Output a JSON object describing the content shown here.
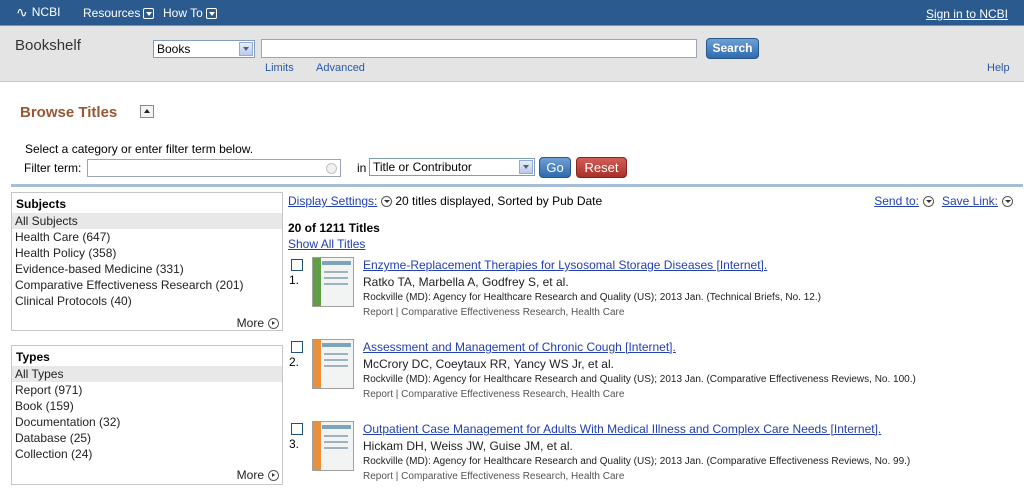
{
  "topbar": {
    "logo_text": "NCBI",
    "menus": [
      "Resources",
      "How To"
    ],
    "signin": "Sign in to NCBI"
  },
  "search": {
    "app_title": "Bookshelf",
    "database": "Books",
    "query": "",
    "button": "Search",
    "limits": "Limits",
    "advanced": "Advanced",
    "help": "Help"
  },
  "browse": {
    "title": "Browse Titles",
    "instructions": "Select a category or enter filter term below.",
    "filter_label": "Filter term:",
    "filter_value": "",
    "in_label": "in",
    "field": "Title or Contributor",
    "go": "Go",
    "reset": "Reset"
  },
  "subjects": {
    "heading": "Subjects",
    "items": [
      "All Subjects",
      "Health Care (647)",
      "Health Policy (358)",
      "Evidence-based Medicine (331)",
      "Comparative Effectiveness Research (201)",
      "Clinical Protocols (40)"
    ],
    "more": "More"
  },
  "types": {
    "heading": "Types",
    "items": [
      "All Types",
      "Report (971)",
      "Book (159)",
      "Documentation (32)",
      "Database (25)",
      "Collection (24)"
    ],
    "more": "More"
  },
  "results_bar": {
    "display_settings": "Display Settings:",
    "summary": "20 titles displayed, Sorted by Pub Date",
    "send_to": "Send to:",
    "save_link": "Save Link:",
    "count": "20 of 1211 Titles",
    "show_all": "Show All Titles"
  },
  "results": [
    {
      "num": "1.",
      "title": "Enzyme-Replacement Therapies for Lysosomal Storage Diseases [Internet].",
      "authors": "Ratko TA, Marbella A, Godfrey S, et al.",
      "pub": "Rockville (MD): Agency for Healthcare Research and Quality (US); 2013 Jan. (Technical Briefs, No. 12.)",
      "tags": "Report | Comparative Effectiveness Research, Health Care",
      "cover_color": "#5f9e47"
    },
    {
      "num": "2.",
      "title": "Assessment and Management of Chronic Cough [Internet].",
      "authors": "McCrory DC, Coeytaux RR, Yancy WS Jr, et al.",
      "pub": "Rockville (MD): Agency for Healthcare Research and Quality (US); 2013 Jan. (Comparative Effectiveness Reviews, No. 100.)",
      "tags": "Report | Comparative Effectiveness Research, Health Care",
      "cover_color": "#e8903e"
    },
    {
      "num": "3.",
      "title": "Outpatient Case Management for Adults With Medical Illness and Complex Care Needs [Internet].",
      "authors": "Hickam DH, Weiss JW, Guise JM, et al.",
      "pub": "Rockville (MD): Agency for Healthcare Research and Quality (US); 2013 Jan. (Comparative Effectiveness Reviews, No. 99.)",
      "tags": "Report | Comparative Effectiveness Research, Health Care",
      "cover_color": "#e8903e"
    }
  ]
}
